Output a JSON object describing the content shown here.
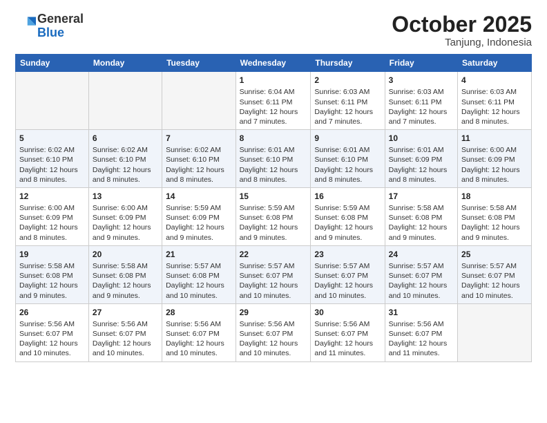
{
  "logo": {
    "line1": "General",
    "line2": "Blue"
  },
  "title": "October 2025",
  "location": "Tanjung, Indonesia",
  "headers": [
    "Sunday",
    "Monday",
    "Tuesday",
    "Wednesday",
    "Thursday",
    "Friday",
    "Saturday"
  ],
  "weeks": [
    [
      {
        "day": "",
        "info": ""
      },
      {
        "day": "",
        "info": ""
      },
      {
        "day": "",
        "info": ""
      },
      {
        "day": "1",
        "info": "Sunrise: 6:04 AM\nSunset: 6:11 PM\nDaylight: 12 hours\nand 7 minutes."
      },
      {
        "day": "2",
        "info": "Sunrise: 6:03 AM\nSunset: 6:11 PM\nDaylight: 12 hours\nand 7 minutes."
      },
      {
        "day": "3",
        "info": "Sunrise: 6:03 AM\nSunset: 6:11 PM\nDaylight: 12 hours\nand 7 minutes."
      },
      {
        "day": "4",
        "info": "Sunrise: 6:03 AM\nSunset: 6:11 PM\nDaylight: 12 hours\nand 8 minutes."
      }
    ],
    [
      {
        "day": "5",
        "info": "Sunrise: 6:02 AM\nSunset: 6:10 PM\nDaylight: 12 hours\nand 8 minutes."
      },
      {
        "day": "6",
        "info": "Sunrise: 6:02 AM\nSunset: 6:10 PM\nDaylight: 12 hours\nand 8 minutes."
      },
      {
        "day": "7",
        "info": "Sunrise: 6:02 AM\nSunset: 6:10 PM\nDaylight: 12 hours\nand 8 minutes."
      },
      {
        "day": "8",
        "info": "Sunrise: 6:01 AM\nSunset: 6:10 PM\nDaylight: 12 hours\nand 8 minutes."
      },
      {
        "day": "9",
        "info": "Sunrise: 6:01 AM\nSunset: 6:10 PM\nDaylight: 12 hours\nand 8 minutes."
      },
      {
        "day": "10",
        "info": "Sunrise: 6:01 AM\nSunset: 6:09 PM\nDaylight: 12 hours\nand 8 minutes."
      },
      {
        "day": "11",
        "info": "Sunrise: 6:00 AM\nSunset: 6:09 PM\nDaylight: 12 hours\nand 8 minutes."
      }
    ],
    [
      {
        "day": "12",
        "info": "Sunrise: 6:00 AM\nSunset: 6:09 PM\nDaylight: 12 hours\nand 8 minutes."
      },
      {
        "day": "13",
        "info": "Sunrise: 6:00 AM\nSunset: 6:09 PM\nDaylight: 12 hours\nand 9 minutes."
      },
      {
        "day": "14",
        "info": "Sunrise: 5:59 AM\nSunset: 6:09 PM\nDaylight: 12 hours\nand 9 minutes."
      },
      {
        "day": "15",
        "info": "Sunrise: 5:59 AM\nSunset: 6:08 PM\nDaylight: 12 hours\nand 9 minutes."
      },
      {
        "day": "16",
        "info": "Sunrise: 5:59 AM\nSunset: 6:08 PM\nDaylight: 12 hours\nand 9 minutes."
      },
      {
        "day": "17",
        "info": "Sunrise: 5:58 AM\nSunset: 6:08 PM\nDaylight: 12 hours\nand 9 minutes."
      },
      {
        "day": "18",
        "info": "Sunrise: 5:58 AM\nSunset: 6:08 PM\nDaylight: 12 hours\nand 9 minutes."
      }
    ],
    [
      {
        "day": "19",
        "info": "Sunrise: 5:58 AM\nSunset: 6:08 PM\nDaylight: 12 hours\nand 9 minutes."
      },
      {
        "day": "20",
        "info": "Sunrise: 5:58 AM\nSunset: 6:08 PM\nDaylight: 12 hours\nand 9 minutes."
      },
      {
        "day": "21",
        "info": "Sunrise: 5:57 AM\nSunset: 6:08 PM\nDaylight: 12 hours\nand 10 minutes."
      },
      {
        "day": "22",
        "info": "Sunrise: 5:57 AM\nSunset: 6:07 PM\nDaylight: 12 hours\nand 10 minutes."
      },
      {
        "day": "23",
        "info": "Sunrise: 5:57 AM\nSunset: 6:07 PM\nDaylight: 12 hours\nand 10 minutes."
      },
      {
        "day": "24",
        "info": "Sunrise: 5:57 AM\nSunset: 6:07 PM\nDaylight: 12 hours\nand 10 minutes."
      },
      {
        "day": "25",
        "info": "Sunrise: 5:57 AM\nSunset: 6:07 PM\nDaylight: 12 hours\nand 10 minutes."
      }
    ],
    [
      {
        "day": "26",
        "info": "Sunrise: 5:56 AM\nSunset: 6:07 PM\nDaylight: 12 hours\nand 10 minutes."
      },
      {
        "day": "27",
        "info": "Sunrise: 5:56 AM\nSunset: 6:07 PM\nDaylight: 12 hours\nand 10 minutes."
      },
      {
        "day": "28",
        "info": "Sunrise: 5:56 AM\nSunset: 6:07 PM\nDaylight: 12 hours\nand 10 minutes."
      },
      {
        "day": "29",
        "info": "Sunrise: 5:56 AM\nSunset: 6:07 PM\nDaylight: 12 hours\nand 10 minutes."
      },
      {
        "day": "30",
        "info": "Sunrise: 5:56 AM\nSunset: 6:07 PM\nDaylight: 12 hours\nand 11 minutes."
      },
      {
        "day": "31",
        "info": "Sunrise: 5:56 AM\nSunset: 6:07 PM\nDaylight: 12 hours\nand 11 minutes."
      },
      {
        "day": "",
        "info": ""
      }
    ]
  ]
}
